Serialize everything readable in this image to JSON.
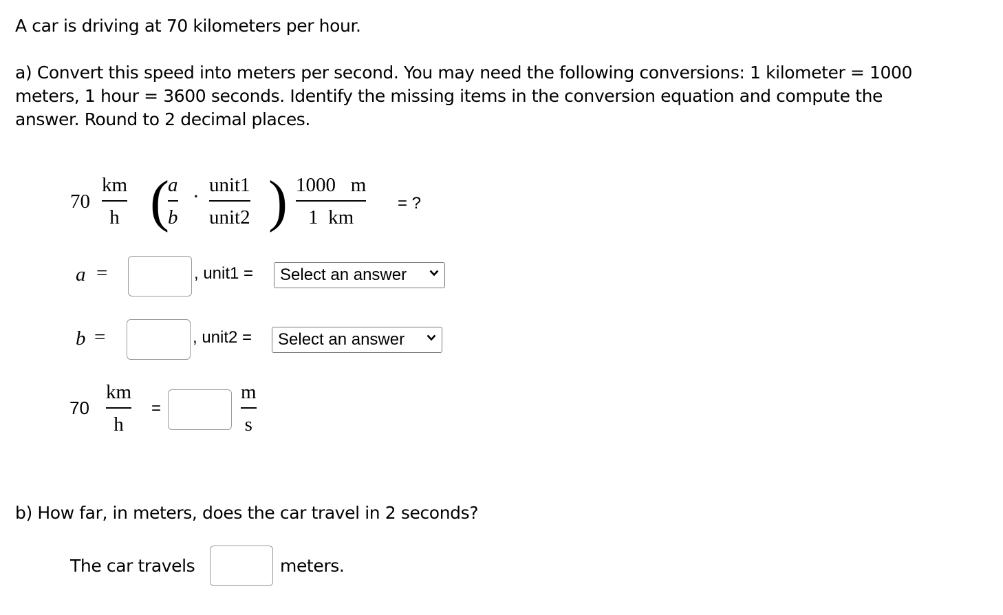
{
  "intro": "A car is driving at 70 kilometers per hour.",
  "part_a": {
    "lines": [
      "a) Convert this speed into meters per second. You may need the following conversions: 1 kilometer = 1000",
      "meters, 1 hour = 3600 seconds. Identify the missing items in the conversion equation and compute the",
      "answer. Round to 2 decimal places."
    ],
    "equation": {
      "value": "70",
      "unit_num": "km",
      "unit_den": "h",
      "var_num": "a",
      "var_den": "b",
      "dot": "·",
      "unit1": "unit1",
      "unit2": "unit2",
      "conv_num": "1000   m",
      "conv_den": "1  km",
      "result": "= ?"
    },
    "a_row": {
      "var": "a",
      "equals": "=",
      "value": "",
      "comma_label": ", unit1 =",
      "select_label": "Select an answer"
    },
    "b_row": {
      "var": "b",
      "equals": "=",
      "value": "",
      "comma_label": ", unit2 =",
      "select_label": "Select an answer"
    },
    "result_row": {
      "value": "70",
      "unit_num": "km",
      "unit_den": "h",
      "equals": "=",
      "answer": "",
      "out_num": "m",
      "out_den": "s"
    }
  },
  "part_b": {
    "question": "b) How far, in meters, does the car travel in 2 seconds?",
    "prefix": "The car travels",
    "answer": "",
    "suffix": "meters."
  }
}
